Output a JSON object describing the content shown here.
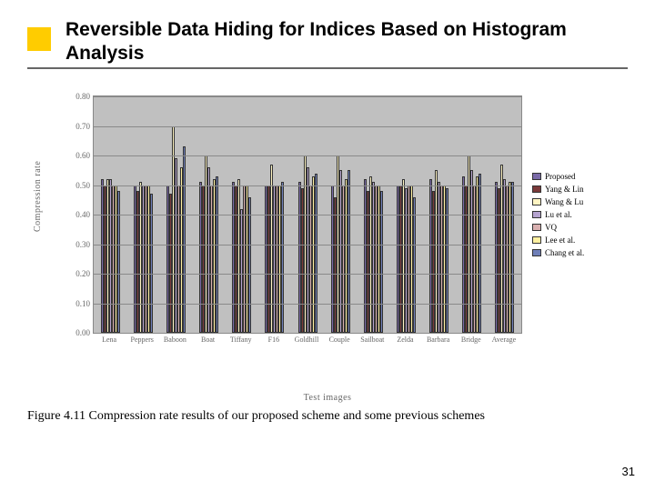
{
  "title": "Reversible Data Hiding for Indices Based on Histogram Analysis",
  "caption": "Figure 4.11 Compression rate results of our proposed scheme and some previous schemes",
  "page_number": "31",
  "yaxis": "Compression rate",
  "xaxis": "Test images",
  "chart_data": {
    "type": "bar",
    "ylim": [
      0,
      0.8
    ],
    "yticks": [
      "0.00",
      "0.10",
      "0.20",
      "0.30",
      "0.40",
      "0.50",
      "0.60",
      "0.70",
      "0.80"
    ],
    "categories": [
      "Lena",
      "Peppers",
      "Baboon",
      "Boat",
      "Tiffany",
      "F16",
      "Goldhill",
      "Couple",
      "Sailboat",
      "Zelda",
      "Barbara",
      "Bridge",
      "Average"
    ],
    "series": [
      {
        "name": "Proposed",
        "color": "#7a6aa8",
        "values": [
          0.52,
          0.5,
          0.5,
          0.51,
          0.51,
          0.5,
          0.51,
          0.5,
          0.52,
          0.5,
          0.52,
          0.53,
          0.51
        ]
      },
      {
        "name": "Yang & Lin",
        "color": "#7a3a3a",
        "values": [
          0.5,
          0.48,
          0.47,
          0.5,
          0.5,
          0.5,
          0.49,
          0.46,
          0.48,
          0.5,
          0.48,
          0.5,
          0.49
        ]
      },
      {
        "name": "Wang & Lu",
        "color": "#fff4c2",
        "values": [
          0.52,
          0.51,
          0.7,
          0.6,
          0.52,
          0.57,
          0.6,
          0.6,
          0.53,
          0.52,
          0.55,
          0.6,
          0.57
        ]
      },
      {
        "name": "Lu et al.",
        "color": "#b5a3cf",
        "values": [
          0.52,
          0.5,
          0.59,
          0.56,
          0.42,
          0.5,
          0.56,
          0.55,
          0.51,
          0.49,
          0.51,
          0.55,
          0.52
        ]
      },
      {
        "name": "VQ",
        "color": "#d9b0b0",
        "values": [
          0.5,
          0.5,
          0.5,
          0.5,
          0.5,
          0.5,
          0.5,
          0.5,
          0.5,
          0.5,
          0.5,
          0.5,
          0.5
        ]
      },
      {
        "name": "Lee et al.",
        "color": "#fff0a0",
        "values": [
          0.5,
          0.5,
          0.56,
          0.52,
          0.5,
          0.5,
          0.53,
          0.52,
          0.5,
          0.5,
          0.5,
          0.53,
          0.51
        ]
      },
      {
        "name": "Chang et al.",
        "color": "#6f7fb8",
        "values": [
          0.48,
          0.47,
          0.63,
          0.53,
          0.46,
          0.51,
          0.54,
          0.55,
          0.48,
          0.46,
          0.49,
          0.54,
          0.51
        ]
      }
    ]
  }
}
